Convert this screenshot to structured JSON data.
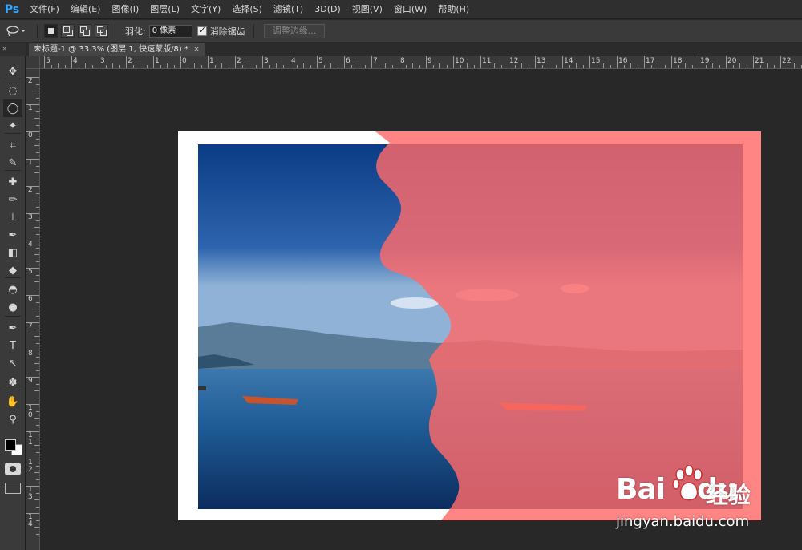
{
  "app": {
    "logo": "Ps"
  },
  "menu": [
    "文件(F)",
    "编辑(E)",
    "图像(I)",
    "图层(L)",
    "文字(Y)",
    "选择(S)",
    "滤镜(T)",
    "3D(D)",
    "视图(V)",
    "窗口(W)",
    "帮助(H)"
  ],
  "options": {
    "tool_icon": "lasso-icon",
    "feather_label": "羽化:",
    "feather_value": "0 像素",
    "antialias_label": "消除锯齿",
    "antialias_checked": true,
    "refine_edge_label": "调整边缘..."
  },
  "panel_header": "»",
  "document_tab": {
    "title": "未标题-1 @ 33.3% (图层 1, 快速蒙版/8) *",
    "close": "×"
  },
  "ruler_top_labels": [
    "5",
    "4",
    "3",
    "2",
    "1",
    "0",
    "1",
    "2",
    "3",
    "4",
    "5",
    "6",
    "7",
    "8",
    "9",
    "10",
    "11",
    "12",
    "13",
    "14",
    "15",
    "16",
    "17",
    "18",
    "19",
    "20",
    "21",
    "22"
  ],
  "ruler_left_labels": [
    "2",
    "1",
    "0",
    "1",
    "2",
    "3",
    "4",
    "5",
    "6",
    "7",
    "8",
    "9",
    "1 0",
    "1 1",
    "1 2",
    "1 3",
    "1 4"
  ],
  "tools": [
    "move-tool-icon",
    "marquee-tool-icon",
    "lasso-tool-icon",
    "magic-wand-tool-icon",
    "crop-tool-icon",
    "eyedropper-tool-icon",
    "healing-brush-tool-icon",
    "brush-tool-icon",
    "clone-stamp-tool-icon",
    "history-brush-tool-icon",
    "eraser-tool-icon",
    "paint-bucket-tool-icon",
    "blur-tool-icon",
    "dodge-tool-icon",
    "pen-tool-icon",
    "type-tool-icon",
    "path-selection-tool-icon",
    "custom-shape-tool-icon",
    "hand-tool-icon",
    "zoom-tool-icon"
  ],
  "tool_glyphs": [
    "✥",
    "◌",
    "◯",
    "✦",
    "⌗",
    "✎",
    "✚",
    "✏",
    "⊥",
    "✒",
    "◧",
    "◆",
    "◓",
    "●",
    "✒",
    "T",
    "↖",
    "✽",
    "✋",
    "⚲"
  ],
  "colors": {
    "foreground": "#000000",
    "background": "#ffffff",
    "quickmask_overlay": "#ff6a6a"
  },
  "watermark": {
    "brand": "Bai",
    "brand_tail": "du",
    "cn": "经验",
    "url": "jingyan.baidu.com"
  }
}
